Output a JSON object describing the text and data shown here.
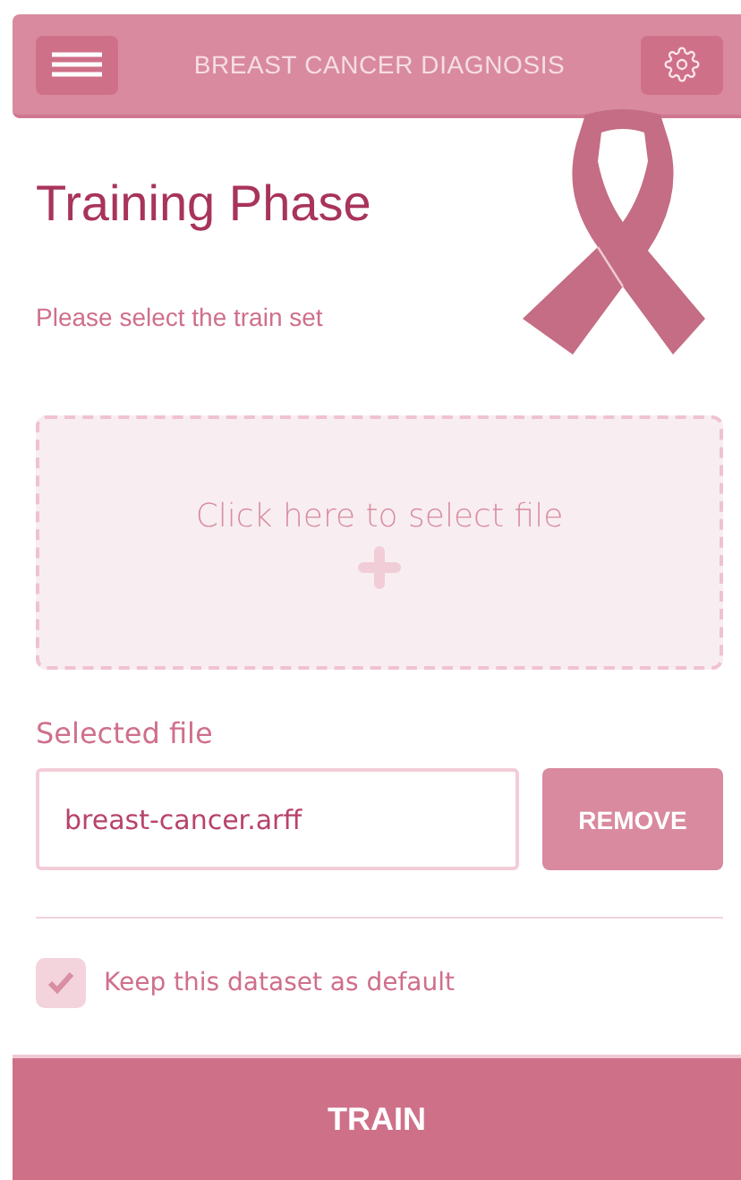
{
  "header": {
    "title": "BREAST CANCER DIAGNOSIS"
  },
  "page": {
    "title": "Training Phase",
    "instruction": "Please select the train set"
  },
  "dropzone": {
    "label": "Click here to select file"
  },
  "selected_file": {
    "label": "Selected file",
    "value": "breast-cancer.arff",
    "remove_button": "REMOVE"
  },
  "default_option": {
    "label": "Keep this dataset as default",
    "checked": true
  },
  "train_button": "TRAIN"
}
